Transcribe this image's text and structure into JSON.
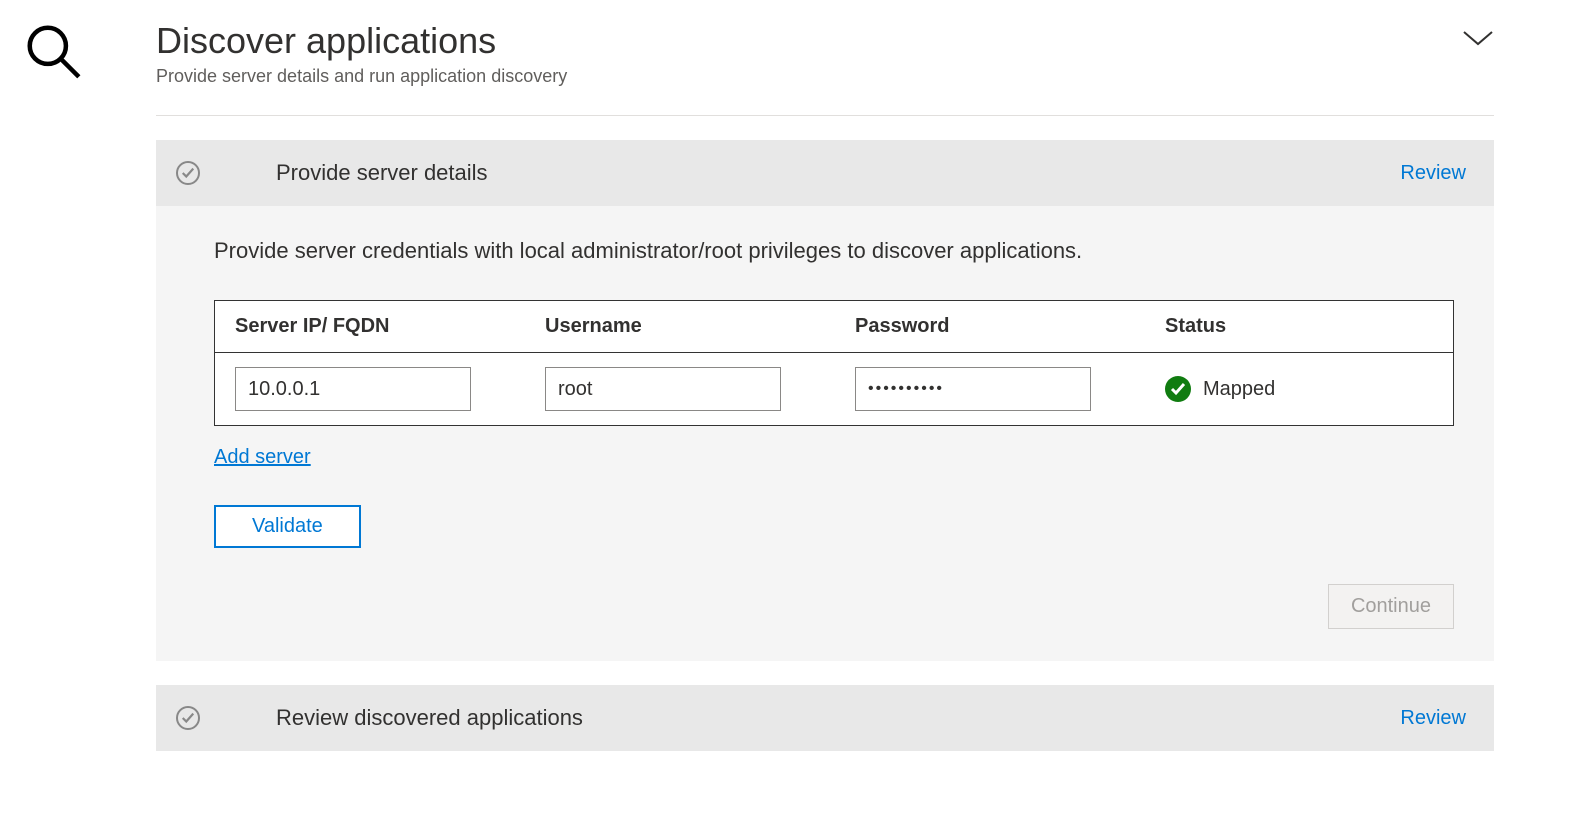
{
  "header": {
    "title": "Discover applications",
    "subtitle": "Provide server details and run application discovery"
  },
  "step1": {
    "title": "Provide server details",
    "review_label": "Review",
    "instruction": "Provide server credentials with local administrator/root privileges to discover applications.",
    "columns": {
      "ip": "Server IP/ FQDN",
      "username": "Username",
      "password": "Password",
      "status": "Status"
    },
    "row": {
      "ip": "10.0.0.1",
      "username": "root",
      "password": "••••••••••",
      "status": "Mapped"
    },
    "add_server_label": "Add server",
    "validate_label": "Validate",
    "continue_label": "Continue"
  },
  "step2": {
    "title": "Review discovered applications",
    "review_label": "Review"
  }
}
